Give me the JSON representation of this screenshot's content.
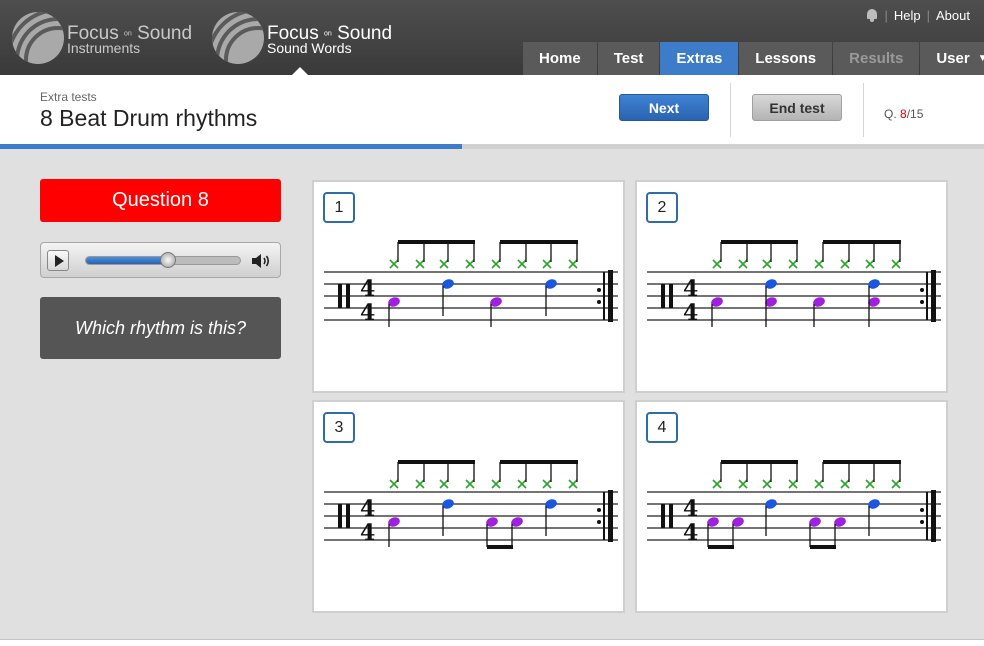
{
  "brand": {
    "name": "Focus",
    "on": "on",
    "name2": "Sound",
    "products": [
      {
        "sub": "Instruments"
      },
      {
        "sub": "Sound Words"
      }
    ]
  },
  "toplinks": {
    "help": "Help",
    "about": "About"
  },
  "nav": [
    {
      "label": "Home",
      "state": "normal"
    },
    {
      "label": "Test",
      "state": "normal"
    },
    {
      "label": "Extras",
      "state": "active"
    },
    {
      "label": "Lessons",
      "state": "normal"
    },
    {
      "label": "Results",
      "state": "disabled"
    },
    {
      "label": "User",
      "state": "normal"
    }
  ],
  "header": {
    "breadcrumb": "Extra tests",
    "title": "8 Beat Drum rhythms",
    "next_label": "Next",
    "end_label": "End test",
    "q_prefix": "Q. ",
    "q_current": "8",
    "q_total": "/15"
  },
  "progress_fraction": 0.47,
  "question": {
    "badge": "Question 8",
    "prompt": "Which rhythm is this?",
    "audio_position_fraction": 0.53
  },
  "options": [
    {
      "number": "1"
    },
    {
      "number": "2"
    },
    {
      "number": "3"
    },
    {
      "number": "4"
    }
  ],
  "colors": {
    "accent": "#3d7cc9",
    "question_badge": "#ff0000",
    "hihat": "#2aa52a",
    "snare": "#1a56e0",
    "kick": "#a020e0"
  }
}
